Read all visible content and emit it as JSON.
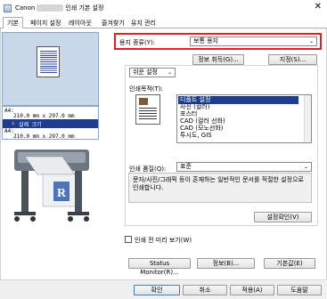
{
  "window": {
    "title_brand": "Canon",
    "title_suffix": "인쇄 기본 설정",
    "close_glyph": "✕"
  },
  "tabs": [
    {
      "label": "기본",
      "active": true
    },
    {
      "label": "페이지 설정"
    },
    {
      "label": "레이아웃"
    },
    {
      "label": "즐겨찾기"
    },
    {
      "label": "유지 관리"
    }
  ],
  "preview": {
    "size_line1": "A4:",
    "size_line2": "210.0 mm x 297.0 mm",
    "size_selected": "실제 크기",
    "size_line3": "A4:",
    "size_line4": "210.0 mm x 297.0 mm"
  },
  "media": {
    "label": "용지 종류(Y):",
    "value": "보통 용지",
    "info_button": "정보 취득(G)...",
    "settings_button": "지정(S)..."
  },
  "mode": {
    "value": "쉬운 설정"
  },
  "print_target": {
    "label": "인쇄목적(T):",
    "items": [
      "디폴트 설정",
      "사진 (컬러)",
      "포스터",
      "CAD (컬러 선화)",
      "CAD (모노선화)",
      "투시도, GIS"
    ]
  },
  "quality": {
    "label": "인쇄 품질(Q):",
    "value": "표준"
  },
  "description": "문자/사진/그래픽 등이 혼재하는 일반적인 문서를 적절한 설정으로 인쇄합니다.",
  "settings_check_button": "설정확인(V)",
  "preview_check": {
    "label": "인쇄 전 미리 보기(W)",
    "checked": false
  },
  "footer_buttons": {
    "status_monitor": "Status Monitor(R)...",
    "info": "정보(B)...",
    "defaults": "기본값(E)"
  },
  "dialog_buttons": {
    "ok": "확인",
    "cancel": "취소",
    "apply": "적용(A)",
    "help": "도움말"
  },
  "colors": {
    "highlight": "#e0201e",
    "selection": "#1f3d8c"
  }
}
